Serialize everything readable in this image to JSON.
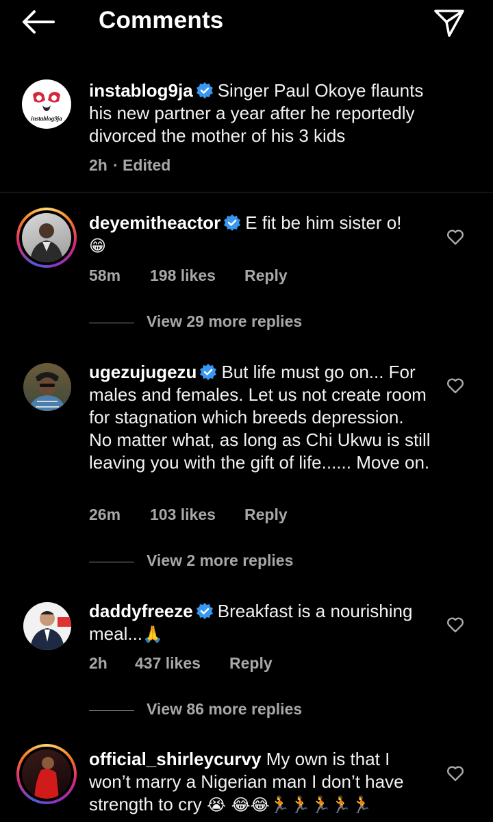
{
  "header": {
    "title": "Comments",
    "back_icon": "arrow-left-icon",
    "send_icon": "paper-plane-icon"
  },
  "caption": {
    "username": "instablog9ja",
    "text": "Singer Paul Okoye flaunts his new partner a year after he reportedly divorced the mother of his 3 kids",
    "time": "2h",
    "edited": "· Edited",
    "avatar_text": "instablog9ja"
  },
  "comments": [
    {
      "username": "deyemitheactor",
      "verified": true,
      "text": "E fit be him sister o!",
      "emoji": "😁",
      "time": "58m",
      "likes": "198 likes",
      "reply": "Reply",
      "view_replies": "View 29 more replies"
    },
    {
      "username": "ugezujugezu",
      "verified": true,
      "text": "But life must go on... For males and females. Let us not create room for stagnation which breeds depression. No matter what, as long as Chi Ukwu is still leaving you with the gift of life...... Move on.",
      "time": "26m",
      "likes": "103 likes",
      "reply": "Reply",
      "view_replies": "View 2 more replies"
    },
    {
      "username": "daddyfreeze",
      "verified": true,
      "text": "Breakfast is a nourishing meal...",
      "emoji": "🙏",
      "time": "2h",
      "likes": "437 likes",
      "reply": "Reply",
      "view_replies": "View 86 more replies"
    },
    {
      "username": "official_shirleycurvy",
      "verified": false,
      "text": "My own is that I won’t marry a Nigerian man I don’t have strength to cry",
      "emoji": "😭 😂😂🏃🏃🏃🏃🏃"
    }
  ],
  "colors": {
    "background": "#000000",
    "text": "#f5f5f5",
    "meta": "#a8a8a8",
    "verified": "#3897f0",
    "divider": "#2c2c2c"
  }
}
